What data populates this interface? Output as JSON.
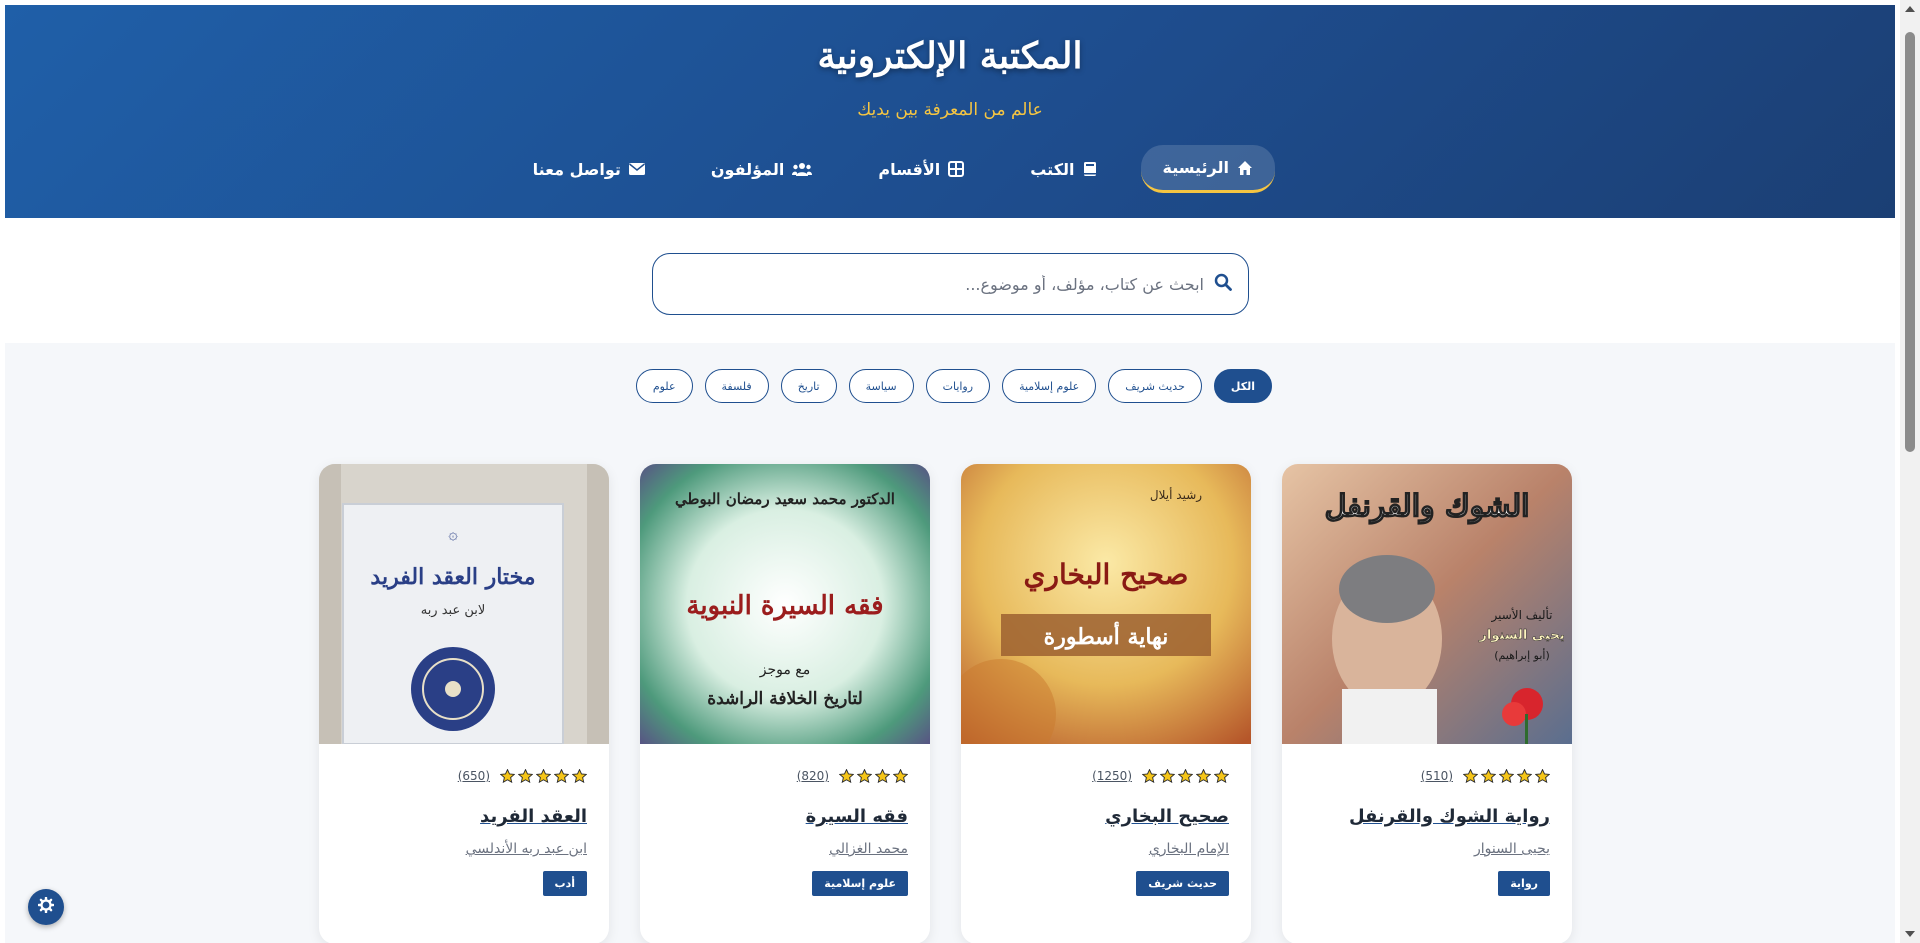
{
  "header": {
    "title": "المكتبة الإلكترونية",
    "tagline": "عالم من المعرفة بين يديك",
    "nav": [
      {
        "label": "الرئيسية",
        "icon": "home-icon",
        "active": true
      },
      {
        "label": "الكتب",
        "icon": "book-icon",
        "active": false
      },
      {
        "label": "الأقسام",
        "icon": "grid-icon",
        "active": false
      },
      {
        "label": "المؤلفون",
        "icon": "users-icon",
        "active": false
      },
      {
        "label": "تواصل معنا",
        "icon": "envelope-icon",
        "active": false
      }
    ]
  },
  "search": {
    "placeholder": "ابحث عن كتاب، مؤلف، أو موضوع...",
    "value": "",
    "icon": "search-icon"
  },
  "filters": [
    {
      "label": "الكل",
      "active": true
    },
    {
      "label": "حديث شريف",
      "active": false
    },
    {
      "label": "علوم إسلامية",
      "active": false
    },
    {
      "label": "روايات",
      "active": false
    },
    {
      "label": "سياسة",
      "active": false
    },
    {
      "label": "تاريخ",
      "active": false
    },
    {
      "label": "فلسفة",
      "active": false
    },
    {
      "label": "علوم",
      "active": false
    }
  ],
  "books": [
    {
      "title": "رواية الشوك والقرنفل",
      "author": "يحيى السنوار",
      "category": "رواية",
      "rating_count": "(510)",
      "stars": 5,
      "cover": {
        "heading": "الشوك والقرنفل",
        "line1": "تأليف الأسير",
        "line2": "يحيى السنوار",
        "line3": "(أبو إبراهيم)",
        "colors": [
          "#c4876a",
          "#7a4a3a",
          "#3b5f8a"
        ]
      }
    },
    {
      "title": "صحيح البخاري",
      "author": "الإمام البخاري",
      "category": "حديث شريف",
      "rating_count": "(1250)",
      "stars": 5,
      "cover": {
        "heading": "صحيح البخاري",
        "line1": "رشيد أيلال",
        "line2": "نهاية أسطورة",
        "line3": "",
        "colors": [
          "#f2d56b",
          "#d9a13a",
          "#b5562a"
        ]
      }
    },
    {
      "title": "فقه السيرة",
      "author": "محمد الغزالي",
      "category": "علوم إسلامية",
      "rating_count": "(820)",
      "stars": 4,
      "cover": {
        "heading": "فقه السيرة النبوية",
        "line1": "الدكتور محمد سعيد رمضان البوطي",
        "line2": "مع موجز",
        "line3": "لتاريخ الخلافة الراشدة",
        "colors": [
          "#e9f5ec",
          "#4e9a7c",
          "#6b4a8e"
        ]
      }
    },
    {
      "title": "العقد الفريد",
      "author": "ابن عبد ربه الأندلسي",
      "category": "أدب",
      "rating_count": "(650)",
      "stars": 5,
      "cover": {
        "heading": "مختار العقد الفريد",
        "line1": "لابن عبد ربه",
        "line2": "",
        "line3": "",
        "colors": [
          "#eef0f3",
          "#c9ced6",
          "#2a3f86"
        ]
      }
    }
  ],
  "settings_icon": "gear-icon"
}
